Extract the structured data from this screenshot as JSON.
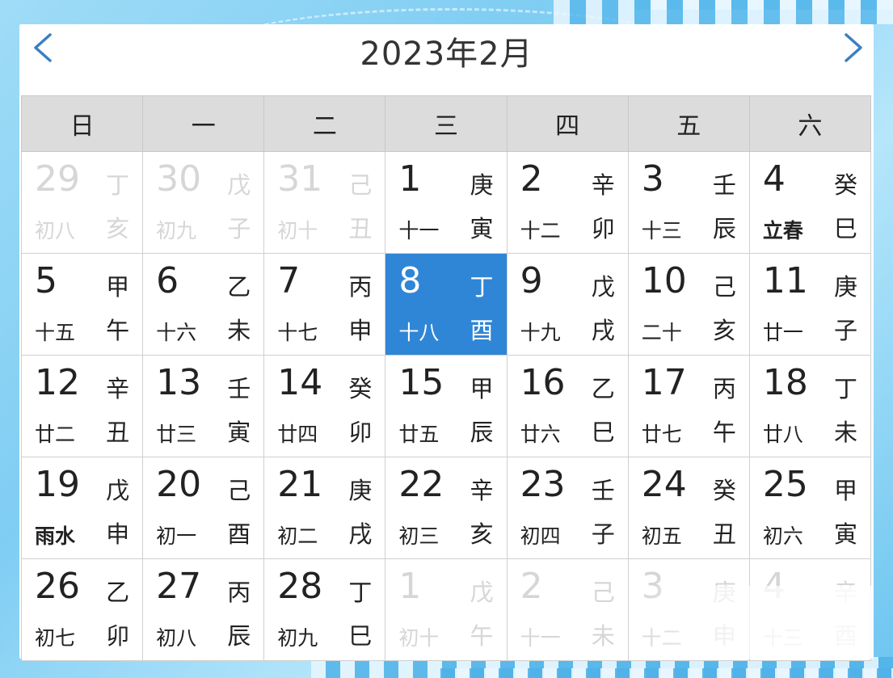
{
  "header": {
    "title": "2023年2月",
    "prev_icon": "chevron-left-icon",
    "next_icon": "chevron-right-icon"
  },
  "colors": {
    "accent": "#2f86d6",
    "arrow": "#3a7fc0",
    "header_bg": "#dcdcdc"
  },
  "weekdays": [
    "日",
    "一",
    "二",
    "三",
    "四",
    "五",
    "六"
  ],
  "weeks": [
    [
      {
        "day": "29",
        "gz_top": "丁",
        "lunar": "初八",
        "gz_bot": "亥",
        "other": true
      },
      {
        "day": "30",
        "gz_top": "戊",
        "lunar": "初九",
        "gz_bot": "子",
        "other": true
      },
      {
        "day": "31",
        "gz_top": "己",
        "lunar": "初十",
        "gz_bot": "丑",
        "other": true
      },
      {
        "day": "1",
        "gz_top": "庚",
        "lunar": "十一",
        "gz_bot": "寅"
      },
      {
        "day": "2",
        "gz_top": "辛",
        "lunar": "十二",
        "gz_bot": "卯"
      },
      {
        "day": "3",
        "gz_top": "壬",
        "lunar": "十三",
        "gz_bot": "辰"
      },
      {
        "day": "4",
        "gz_top": "癸",
        "lunar": "立春",
        "gz_bot": "巳",
        "term": true
      }
    ],
    [
      {
        "day": "5",
        "gz_top": "甲",
        "lunar": "十五",
        "gz_bot": "午"
      },
      {
        "day": "6",
        "gz_top": "乙",
        "lunar": "十六",
        "gz_bot": "未"
      },
      {
        "day": "7",
        "gz_top": "丙",
        "lunar": "十七",
        "gz_bot": "申"
      },
      {
        "day": "8",
        "gz_top": "丁",
        "lunar": "十八",
        "gz_bot": "酉",
        "selected": true
      },
      {
        "day": "9",
        "gz_top": "戊",
        "lunar": "十九",
        "gz_bot": "戌"
      },
      {
        "day": "10",
        "gz_top": "己",
        "lunar": "二十",
        "gz_bot": "亥"
      },
      {
        "day": "11",
        "gz_top": "庚",
        "lunar": "廿一",
        "gz_bot": "子"
      }
    ],
    [
      {
        "day": "12",
        "gz_top": "辛",
        "lunar": "廿二",
        "gz_bot": "丑"
      },
      {
        "day": "13",
        "gz_top": "壬",
        "lunar": "廿三",
        "gz_bot": "寅"
      },
      {
        "day": "14",
        "gz_top": "癸",
        "lunar": "廿四",
        "gz_bot": "卯"
      },
      {
        "day": "15",
        "gz_top": "甲",
        "lunar": "廿五",
        "gz_bot": "辰"
      },
      {
        "day": "16",
        "gz_top": "乙",
        "lunar": "廿六",
        "gz_bot": "巳"
      },
      {
        "day": "17",
        "gz_top": "丙",
        "lunar": "廿七",
        "gz_bot": "午"
      },
      {
        "day": "18",
        "gz_top": "丁",
        "lunar": "廿八",
        "gz_bot": "未"
      }
    ],
    [
      {
        "day": "19",
        "gz_top": "戊",
        "lunar": "雨水",
        "gz_bot": "申",
        "term": true
      },
      {
        "day": "20",
        "gz_top": "己",
        "lunar": "初一",
        "gz_bot": "酉"
      },
      {
        "day": "21",
        "gz_top": "庚",
        "lunar": "初二",
        "gz_bot": "戌"
      },
      {
        "day": "22",
        "gz_top": "辛",
        "lunar": "初三",
        "gz_bot": "亥"
      },
      {
        "day": "23",
        "gz_top": "壬",
        "lunar": "初四",
        "gz_bot": "子"
      },
      {
        "day": "24",
        "gz_top": "癸",
        "lunar": "初五",
        "gz_bot": "丑"
      },
      {
        "day": "25",
        "gz_top": "甲",
        "lunar": "初六",
        "gz_bot": "寅"
      }
    ],
    [
      {
        "day": "26",
        "gz_top": "乙",
        "lunar": "初七",
        "gz_bot": "卯"
      },
      {
        "day": "27",
        "gz_top": "丙",
        "lunar": "初八",
        "gz_bot": "辰"
      },
      {
        "day": "28",
        "gz_top": "丁",
        "lunar": "初九",
        "gz_bot": "巳"
      },
      {
        "day": "1",
        "gz_top": "戊",
        "lunar": "初十",
        "gz_bot": "午",
        "other": true
      },
      {
        "day": "2",
        "gz_top": "己",
        "lunar": "十一",
        "gz_bot": "未",
        "other": true
      },
      {
        "day": "3",
        "gz_top": "庚",
        "lunar": "十二",
        "gz_bot": "申",
        "other": true
      },
      {
        "day": "4",
        "gz_top": "辛",
        "lunar": "十三",
        "gz_bot": "酉",
        "other": true
      }
    ]
  ]
}
